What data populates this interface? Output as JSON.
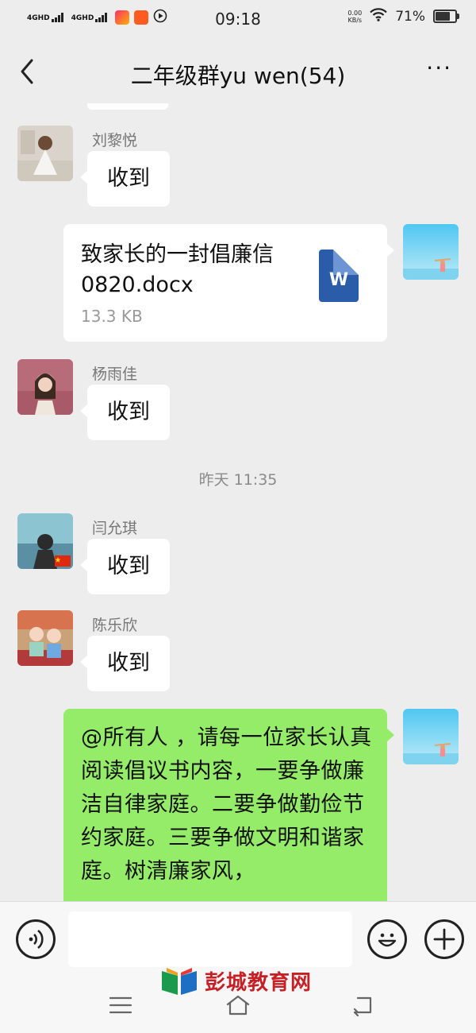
{
  "status_bar": {
    "net1_label": "4GHD",
    "net2_label": "4GHD",
    "time": "09:18",
    "speed_value": "0.00",
    "speed_unit": "KB/s",
    "battery_percent": "71%",
    "battery_level": 0.71
  },
  "header": {
    "title": "二年级群yu wen(54)",
    "more_label": "···"
  },
  "messages": [
    {
      "sender": "刘黎悦",
      "text": "收到"
    },
    {
      "file_name": "致家长的一封倡廉信  0820.docx",
      "file_size": "13.3 KB",
      "file_icon_letter": "W"
    },
    {
      "sender": "杨雨佳",
      "text": "收到"
    },
    {
      "time_divider": "昨天 11:35"
    },
    {
      "sender": "闫允琪",
      "text": "收到"
    },
    {
      "sender": "陈乐欣",
      "text": "收到"
    },
    {
      "text": "@所有人 ，请每一位家长认真阅读倡议书内容，一要争做廉洁自律家庭。二要争做勤俭节约家庭。三要争做文明和谐家庭。树清廉家风，"
    }
  ],
  "input": {
    "value": ""
  },
  "watermark": {
    "text": "彭城教育网"
  },
  "colors": {
    "background": "#ededed",
    "bubble_green": "#95ec69",
    "bubble_white": "#ffffff",
    "word_blue": "#2a5caa"
  },
  "icons": [
    "back-icon",
    "more-icon",
    "voice-icon",
    "emoji-icon",
    "plus-icon",
    "word-doc-icon",
    "menu-icon",
    "home-icon",
    "back-nav-icon"
  ]
}
